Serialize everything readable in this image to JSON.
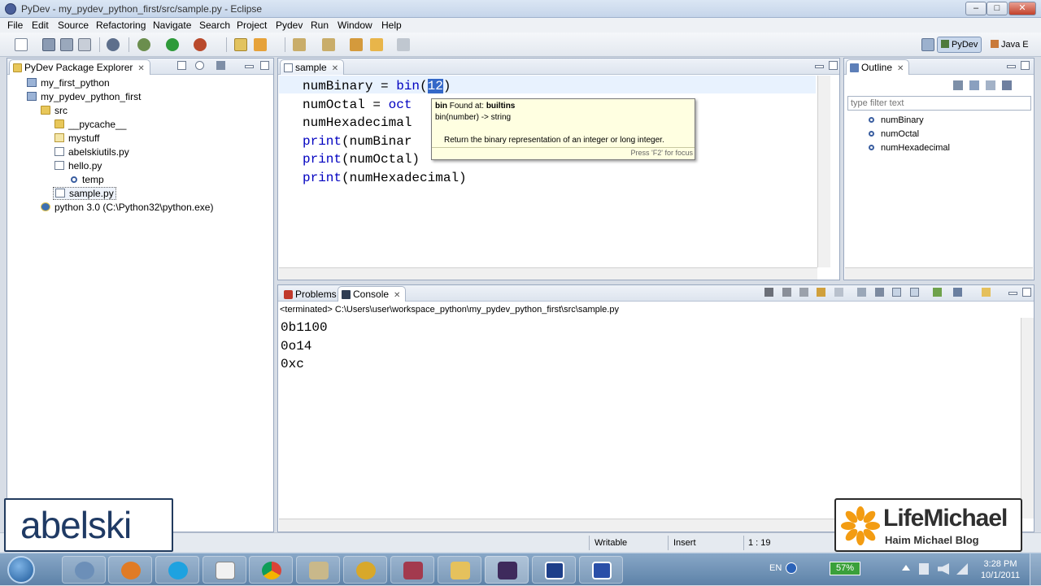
{
  "window": {
    "title": "PyDev - my_pydev_python_first/src/sample.py - Eclipse"
  },
  "menu": [
    "File",
    "Edit",
    "Source",
    "Refactoring",
    "Navigate",
    "Search",
    "Project",
    "Pydev",
    "Run",
    "Window",
    "Help"
  ],
  "perspectives": {
    "active": "PyDev",
    "other": "Java E"
  },
  "explorer": {
    "title": "PyDev Package Explorer",
    "items": [
      {
        "label": "my_first_python",
        "icon": "project-icon"
      },
      {
        "label": "my_pydev_python_first",
        "icon": "project-open-icon"
      },
      {
        "label": "src",
        "icon": "source-folder-icon"
      },
      {
        "label": "__pycache__",
        "icon": "folder-icon"
      },
      {
        "label": "mystuff",
        "icon": "package-icon"
      },
      {
        "label": "abelskiutils.py",
        "icon": "python-file-icon"
      },
      {
        "label": "hello.py",
        "icon": "python-file-icon"
      },
      {
        "label": "temp",
        "icon": "function-icon"
      },
      {
        "label": "sample.py",
        "icon": "python-file-icon"
      },
      {
        "label": "python 3.0  (C:\\Python32\\python.exe)",
        "icon": "python-interpreter-icon"
      }
    ]
  },
  "editor": {
    "tab": "sample",
    "lines": [
      {
        "pre": "numBinary = ",
        "kw": "bin",
        "mid": "(",
        "sel": "12",
        "post": ")"
      },
      {
        "pre": "numOctal = ",
        "kw": "oct",
        "mid": "",
        "sel": "",
        "post": ""
      },
      {
        "pre": "numHexadecimal",
        "kw": "",
        "mid": "",
        "sel": "",
        "post": ""
      },
      {
        "pre": "",
        "kw": "print",
        "mid": "(numBinar",
        "sel": "",
        "post": ""
      },
      {
        "pre": "",
        "kw": "print",
        "mid": "(numOctal)",
        "sel": "",
        "post": ""
      },
      {
        "pre": "",
        "kw": "print",
        "mid": "(numHexadecimal)",
        "sel": "",
        "post": ""
      }
    ]
  },
  "tooltip": {
    "name": "bin",
    "found_at": "Found at: ",
    "module": "builtins",
    "signature": "bin(number) -> string",
    "doc": "Return the binary representation of an integer or long integer.",
    "hint": "Press 'F2' for focus"
  },
  "outline": {
    "title": "Outline",
    "filter_placeholder": "type filter text",
    "items": [
      "numBinary",
      "numOctal",
      "numHexadecimal"
    ]
  },
  "bottom_tabs": {
    "problems": "Problems",
    "console": "Console"
  },
  "console": {
    "header": "<terminated> C:\\Users\\user\\workspace_python\\my_pydev_python_first\\src\\sample.py",
    "output": [
      "0b1100",
      "0o14",
      "0xc"
    ]
  },
  "status": {
    "writable": "Writable",
    "mode": "Insert",
    "position": "1 : 19"
  },
  "tray": {
    "lang": "EN",
    "battery": "57%",
    "time": "3:28 PM",
    "date": "10/1/2011"
  },
  "watermarks": {
    "left": "abelski",
    "right_title": "LifeMichael",
    "right_sub": "Haim Michael Blog"
  },
  "colors": {
    "keyword": "#0000c0",
    "selection": "#3468c8",
    "tooltip_bg": "#ffffe1",
    "brand_orange": "#f39c12"
  }
}
